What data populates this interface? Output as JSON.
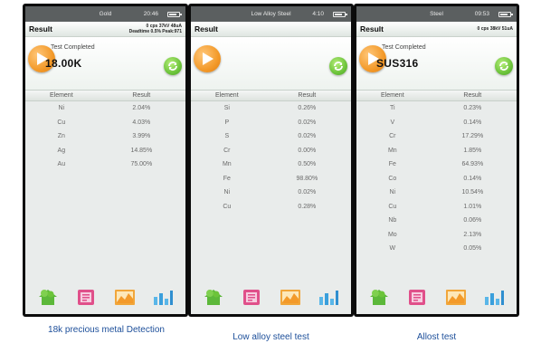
{
  "panels": [
    {
      "status_title": "Gold",
      "status_time": "20:46",
      "header_title": "Result",
      "meta_line1": "0 cps 37kV 48uA",
      "meta_line2": "Deadtime 0.5% Peak:971",
      "test_status": "Test Completed",
      "grade": "18.00K",
      "col_element": "Element",
      "col_result": "Result",
      "rows": [
        {
          "element": "Ni",
          "result": "2.04%"
        },
        {
          "element": "Cu",
          "result": "4.03%"
        },
        {
          "element": "Zn",
          "result": "3.99%"
        },
        {
          "element": "Ag",
          "result": "14.85%"
        },
        {
          "element": "Au",
          "result": "75.00%"
        }
      ],
      "caption": "18k precious metal Detection"
    },
    {
      "status_title": "Low Alloy Steel",
      "status_time": "4:10",
      "header_title": "Result",
      "meta_line1": "",
      "meta_line2": "",
      "test_status": "",
      "grade": "",
      "col_element": "Element",
      "col_result": "Result",
      "rows": [
        {
          "element": "Si",
          "result": "0.26%"
        },
        {
          "element": "P",
          "result": "0.02%"
        },
        {
          "element": "S",
          "result": "0.02%"
        },
        {
          "element": "Cr",
          "result": "0.00%"
        },
        {
          "element": "Mn",
          "result": "0.50%"
        },
        {
          "element": "Fe",
          "result": "98.80%"
        },
        {
          "element": "Ni",
          "result": "0.02%"
        },
        {
          "element": "Cu",
          "result": "0.28%"
        }
      ],
      "caption": "Low alloy steel test"
    },
    {
      "status_title": "Steel",
      "status_time": "09:53",
      "header_title": "Result",
      "meta_line1": "0 cps 38kV 51uA",
      "meta_line2": "",
      "test_status": "Test Completed",
      "grade": "SUS316",
      "col_element": "Element",
      "col_result": "Result",
      "rows": [
        {
          "element": "Ti",
          "result": "0.23%"
        },
        {
          "element": "V",
          "result": "0.14%"
        },
        {
          "element": "Cr",
          "result": "17.29%"
        },
        {
          "element": "Mn",
          "result": "1.85%"
        },
        {
          "element": "Fe",
          "result": "64.93%"
        },
        {
          "element": "Co",
          "result": "0.14%"
        },
        {
          "element": "Ni",
          "result": "10.54%"
        },
        {
          "element": "Cu",
          "result": "1.01%"
        },
        {
          "element": "Nb",
          "result": "0.06%"
        },
        {
          "element": "Mo",
          "result": "2.13%"
        },
        {
          "element": "W",
          "result": "0.05%"
        }
      ],
      "caption": "Allost test"
    }
  ],
  "dock_icons": [
    "home-icon",
    "report-icon",
    "chart-icon",
    "spectrum-icon"
  ],
  "colors": {
    "caption": "#1d4f9a",
    "play_orange": "#f39a2a",
    "refresh_green": "#6cc43a",
    "home_green": "#5cb83a",
    "report_pink": "#e0508a"
  }
}
